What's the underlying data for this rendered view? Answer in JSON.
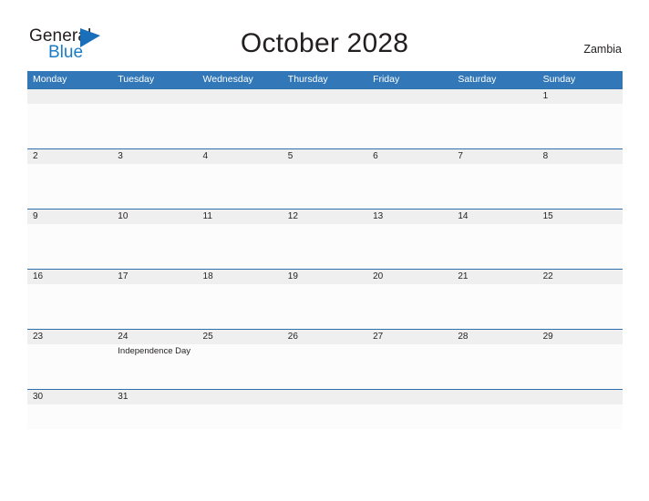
{
  "brand": {
    "name_part1": "General",
    "name_part2": "Blue",
    "flag_icon": "triangle-flag-icon",
    "color_dark": "#231f20",
    "color_blue": "#1a7bc6"
  },
  "header": {
    "title": "October 2028",
    "country": "Zambia"
  },
  "theme": {
    "header_blue": "#3278b8",
    "row_line_blue": "#2e6fae",
    "daynum_band": "#efefef",
    "cell_body": "#fcfcfc"
  },
  "weekdays": [
    "Monday",
    "Tuesday",
    "Wednesday",
    "Thursday",
    "Friday",
    "Saturday",
    "Sunday"
  ],
  "weeks": [
    {
      "short": false,
      "days": [
        {
          "num": "",
          "event": ""
        },
        {
          "num": "",
          "event": ""
        },
        {
          "num": "",
          "event": ""
        },
        {
          "num": "",
          "event": ""
        },
        {
          "num": "",
          "event": ""
        },
        {
          "num": "",
          "event": ""
        },
        {
          "num": "1",
          "event": ""
        }
      ]
    },
    {
      "short": false,
      "days": [
        {
          "num": "2",
          "event": ""
        },
        {
          "num": "3",
          "event": ""
        },
        {
          "num": "4",
          "event": ""
        },
        {
          "num": "5",
          "event": ""
        },
        {
          "num": "6",
          "event": ""
        },
        {
          "num": "7",
          "event": ""
        },
        {
          "num": "8",
          "event": ""
        }
      ]
    },
    {
      "short": false,
      "days": [
        {
          "num": "9",
          "event": ""
        },
        {
          "num": "10",
          "event": ""
        },
        {
          "num": "11",
          "event": ""
        },
        {
          "num": "12",
          "event": ""
        },
        {
          "num": "13",
          "event": ""
        },
        {
          "num": "14",
          "event": ""
        },
        {
          "num": "15",
          "event": ""
        }
      ]
    },
    {
      "short": false,
      "days": [
        {
          "num": "16",
          "event": ""
        },
        {
          "num": "17",
          "event": ""
        },
        {
          "num": "18",
          "event": ""
        },
        {
          "num": "19",
          "event": ""
        },
        {
          "num": "20",
          "event": ""
        },
        {
          "num": "21",
          "event": ""
        },
        {
          "num": "22",
          "event": ""
        }
      ]
    },
    {
      "short": false,
      "days": [
        {
          "num": "23",
          "event": ""
        },
        {
          "num": "24",
          "event": "Independence Day"
        },
        {
          "num": "25",
          "event": ""
        },
        {
          "num": "26",
          "event": ""
        },
        {
          "num": "27",
          "event": ""
        },
        {
          "num": "28",
          "event": ""
        },
        {
          "num": "29",
          "event": ""
        }
      ]
    },
    {
      "short": true,
      "days": [
        {
          "num": "30",
          "event": ""
        },
        {
          "num": "31",
          "event": ""
        },
        {
          "num": "",
          "event": ""
        },
        {
          "num": "",
          "event": ""
        },
        {
          "num": "",
          "event": ""
        },
        {
          "num": "",
          "event": ""
        },
        {
          "num": "",
          "event": ""
        }
      ]
    }
  ]
}
